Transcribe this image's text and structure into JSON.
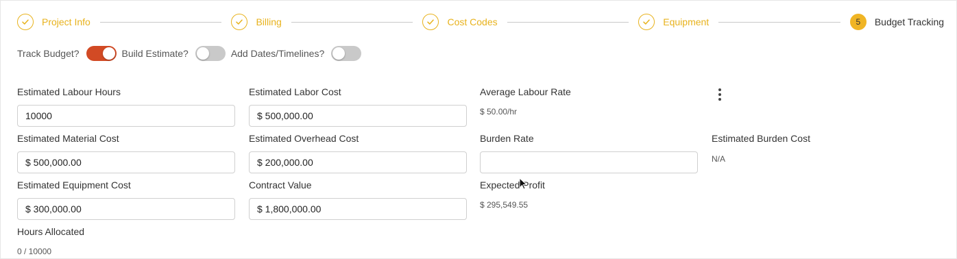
{
  "stepper": {
    "steps": [
      {
        "label": "Project Info",
        "state": "complete"
      },
      {
        "label": "Billing",
        "state": "complete"
      },
      {
        "label": "Cost Codes",
        "state": "complete"
      },
      {
        "label": "Equipment",
        "state": "complete"
      },
      {
        "label": "Budget Tracking",
        "state": "active",
        "number": "5"
      }
    ]
  },
  "toggles": {
    "track_budget": {
      "label": "Track Budget?",
      "on": true
    },
    "build_estimate": {
      "label": "Build Estimate?",
      "on": false
    },
    "add_dates": {
      "label": "Add Dates/Timelines?",
      "on": false
    }
  },
  "fields": {
    "est_labour_hours": {
      "label": "Estimated Labour Hours",
      "value": "10000"
    },
    "est_labor_cost": {
      "label": "Estimated Labor Cost",
      "value": "$ 500,000.00"
    },
    "avg_labour_rate": {
      "label": "Average Labour Rate",
      "value": "$ 50.00/hr"
    },
    "est_material_cost": {
      "label": "Estimated Material Cost",
      "value": "$ 500,000.00"
    },
    "est_overhead_cost": {
      "label": "Estimated Overhead Cost",
      "value": "$ 200,000.00"
    },
    "burden_rate": {
      "label": "Burden Rate",
      "value": ""
    },
    "est_burden_cost": {
      "label": "Estimated Burden Cost",
      "value": "N/A"
    },
    "est_equipment_cost": {
      "label": "Estimated Equipment Cost",
      "value": "$ 300,000.00"
    },
    "contract_value": {
      "label": "Contract Value",
      "value": "$ 1,800,000.00"
    },
    "expected_profit": {
      "label": "Expected Profit",
      "value": "$ 295,549.55"
    },
    "hours_allocated": {
      "label": "Hours Allocated",
      "value": "0 / 10000"
    }
  },
  "colors": {
    "accent": "#e8b21c",
    "toggle_on": "#d24a24",
    "toggle_off": "#c9c9c9"
  },
  "icons": {
    "step_complete": "check-icon",
    "more": "kebab-menu-icon",
    "pointer": "mouse-cursor-icon"
  }
}
